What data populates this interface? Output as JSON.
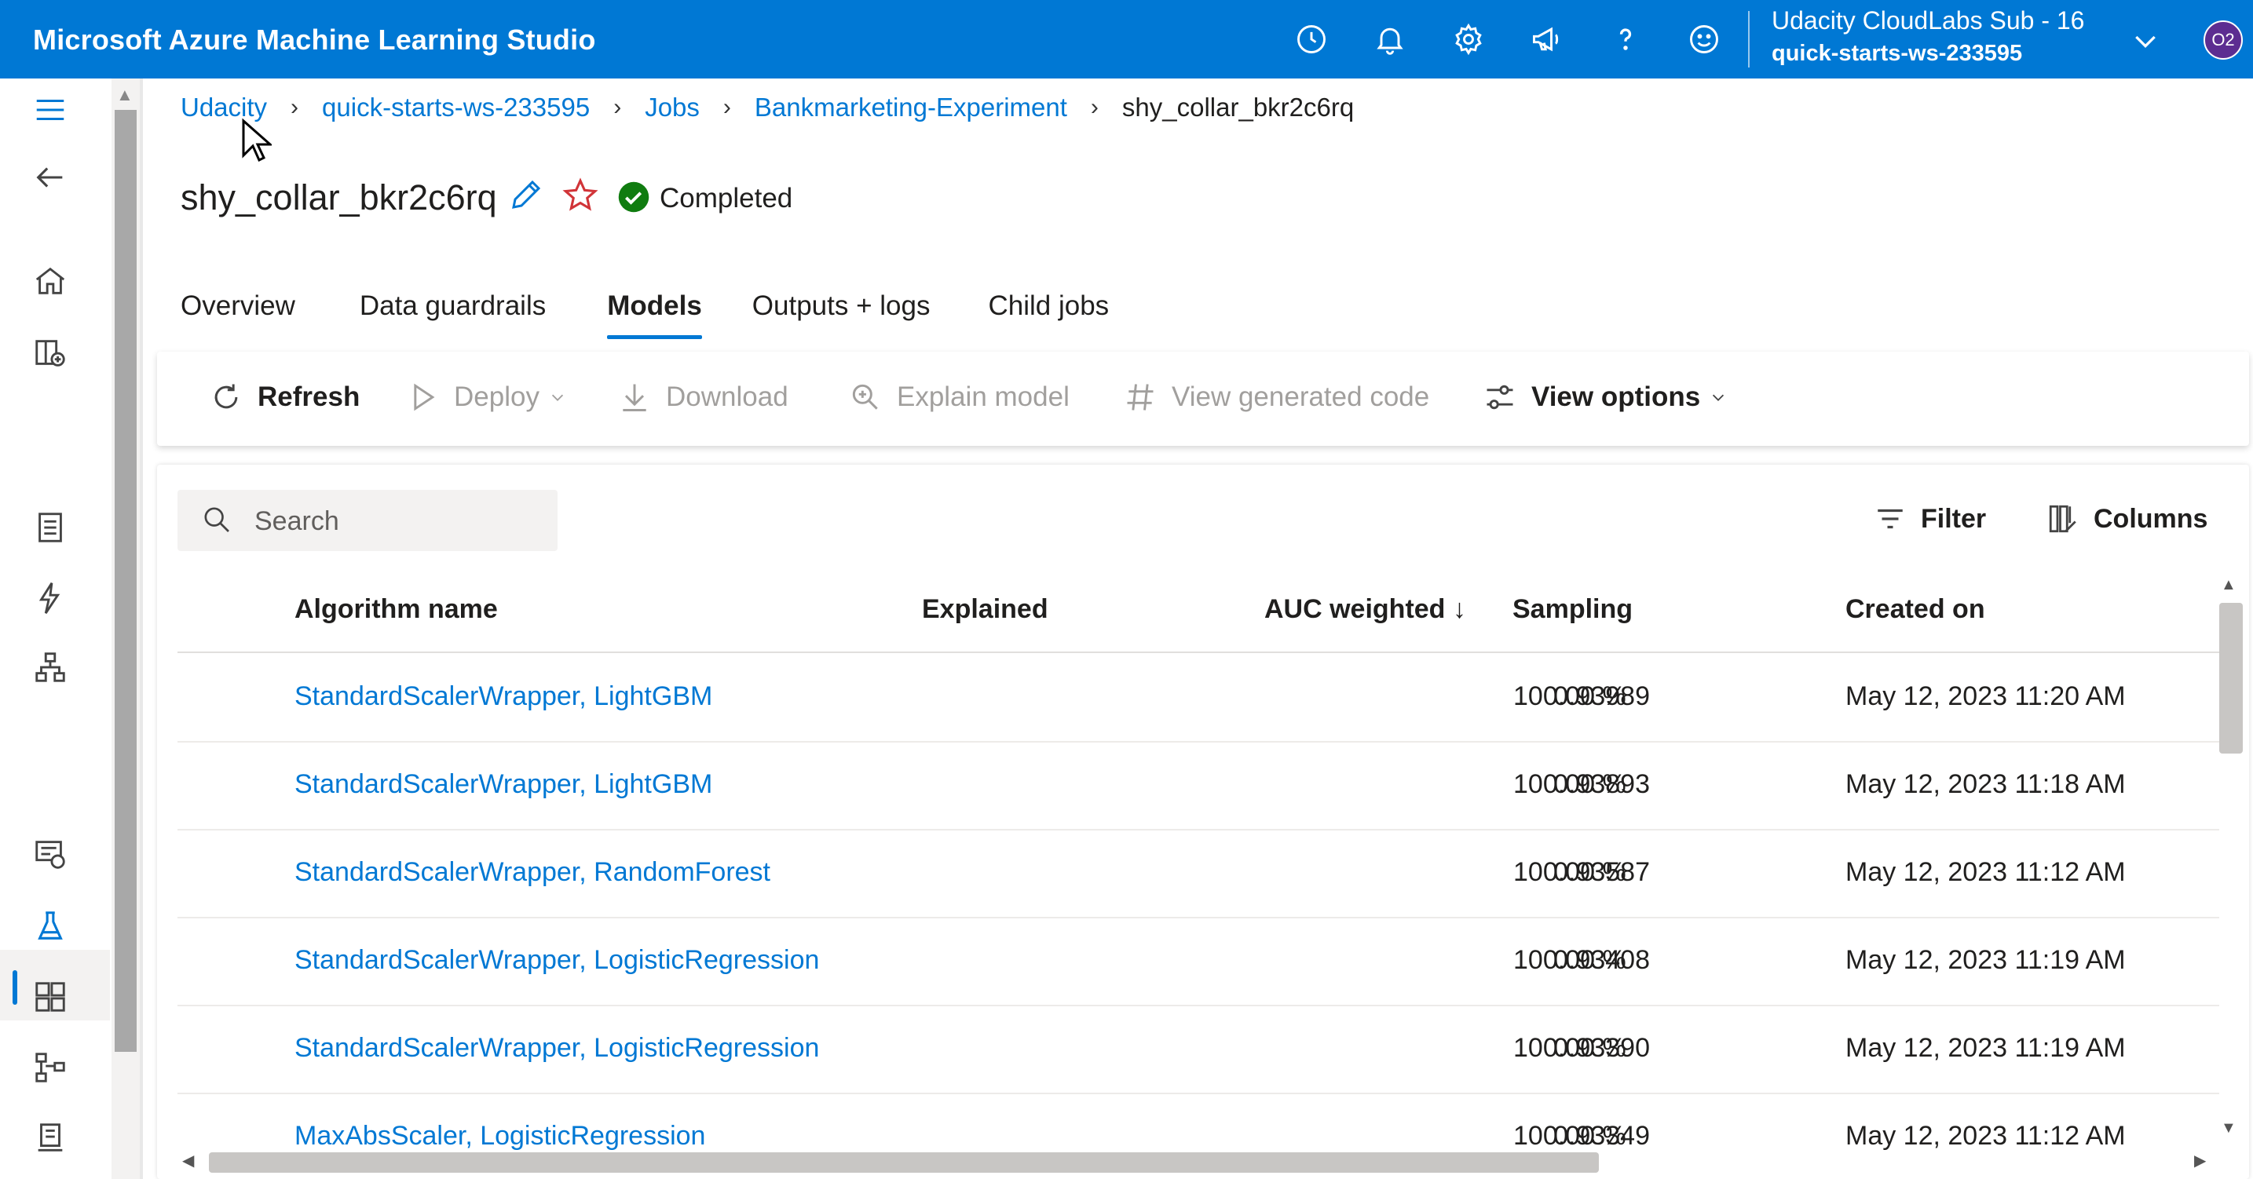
{
  "header": {
    "app_title": "Microsoft Azure Machine Learning Studio",
    "icons": [
      "history-icon",
      "bell-icon",
      "gear-icon",
      "megaphone-icon",
      "help-icon",
      "smiley-icon"
    ],
    "account": {
      "subscription": "Udacity CloudLabs Sub - 16",
      "workspace": "quick-starts-ws-233595",
      "avatar_initials": "O2"
    },
    "color": "#0078d4"
  },
  "leftnav": {
    "icons": [
      "hamburger-icon",
      "back-icon",
      "home-icon",
      "model-catalog-icon",
      "notebook-icon",
      "automl-icon",
      "designer-icon",
      "data-icon",
      "jobs-icon",
      "components-icon",
      "pipelines-icon",
      "environments-icon"
    ],
    "active": "jobs-icon"
  },
  "breadcrumb": {
    "items": [
      "Udacity",
      "quick-starts-ws-233595",
      "Jobs",
      "Bankmarketing-Experiment"
    ],
    "current": "shy_collar_bkr2c6rq"
  },
  "job": {
    "title": "shy_collar_bkr2c6rq",
    "status": "Completed",
    "status_color": "#107c10"
  },
  "tabs": [
    "Overview",
    "Data guardrails",
    "Models",
    "Outputs + logs",
    "Child jobs"
  ],
  "active_tab": "Models",
  "toolbar": {
    "refresh": "Refresh",
    "deploy": "Deploy",
    "download": "Download",
    "explain": "Explain model",
    "view_code": "View generated code",
    "view_options": "View options"
  },
  "table": {
    "search_placeholder": "Search",
    "filter_label": "Filter",
    "columns_label": "Columns",
    "headers": {
      "algorithm": "Algorithm name",
      "explained": "Explained",
      "auc": "AUC weighted ↓",
      "sampling": "Sampling",
      "created": "Created on"
    },
    "rows": [
      {
        "algorithm": "StandardScalerWrapper, LightGBM",
        "explained": "",
        "auc": "0.93989",
        "sampling": "100.00 %",
        "created": "May 12, 2023 11:20 AM"
      },
      {
        "algorithm": "StandardScalerWrapper, LightGBM",
        "explained": "",
        "auc": "0.93893",
        "sampling": "100.00 %",
        "created": "May 12, 2023 11:18 AM"
      },
      {
        "algorithm": "StandardScalerWrapper, RandomForest",
        "explained": "",
        "auc": "0.93587",
        "sampling": "100.00 %",
        "created": "May 12, 2023 11:12 AM"
      },
      {
        "algorithm": "StandardScalerWrapper, LogisticRegression",
        "explained": "",
        "auc": "0.93408",
        "sampling": "100.00 %",
        "created": "May 12, 2023 11:19 AM"
      },
      {
        "algorithm": "StandardScalerWrapper, LogisticRegression",
        "explained": "",
        "auc": "0.93390",
        "sampling": "100.00 %",
        "created": "May 12, 2023 11:19 AM"
      },
      {
        "algorithm": "MaxAbsScaler, LogisticRegression",
        "explained": "",
        "auc": "0.93349",
        "sampling": "100.00 %",
        "created": "May 12, 2023 11:12 AM"
      }
    ]
  }
}
